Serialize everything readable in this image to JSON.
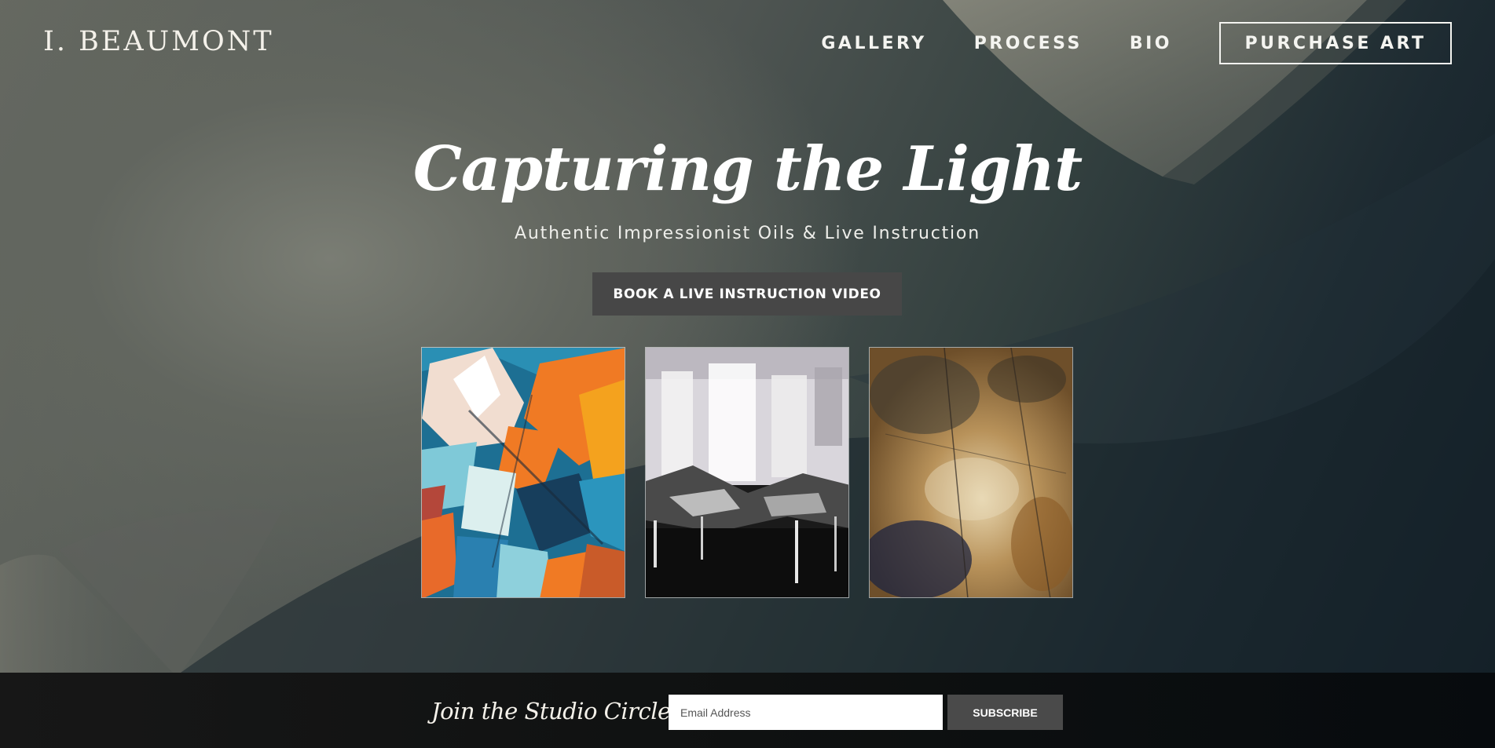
{
  "header": {
    "logo": "I. BEAUMONT",
    "nav": [
      {
        "label": "GALLERY"
      },
      {
        "label": "PROCESS"
      },
      {
        "label": "BIO"
      }
    ],
    "cta_label": "PURCHASE ART"
  },
  "hero": {
    "title": "Capturing the Light",
    "subtitle": "Authentic Impressionist Oils & Live Instruction",
    "cta_label": "BOOK A LIVE INSTRUCTION VIDEO"
  },
  "gallery": {
    "paintings": [
      {
        "style": "abstract colorful",
        "palette": [
          "#f07a24",
          "#1f7fa3",
          "#f2d8c6"
        ]
      },
      {
        "style": "black and white abstract",
        "palette": [
          "#eeeeee",
          "#1a1a1a",
          "#8a8a8a"
        ]
      },
      {
        "style": "textured bronze",
        "palette": [
          "#a8814a",
          "#d6c7a0",
          "#1e2440"
        ]
      }
    ]
  },
  "newsletter": {
    "title": "Join the Studio Circle",
    "email_placeholder": "Email Address",
    "subscribe_label": "SUBSCRIBE"
  },
  "colors": {
    "accent_button": "#474747",
    "footer_band": "#0f1111",
    "text": "#ffffff"
  }
}
